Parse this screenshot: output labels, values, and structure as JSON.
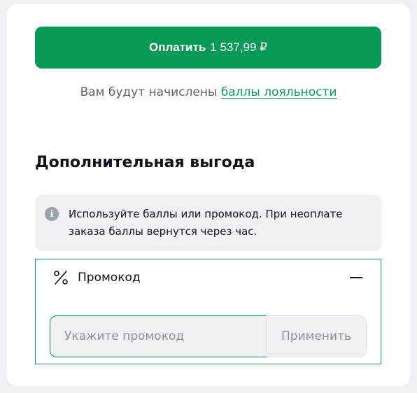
{
  "payment": {
    "pay_label": "Оплатить",
    "amount": "1 537,99 ₽"
  },
  "loyalty": {
    "prefix": "Вам будут начислены ",
    "link_text": "баллы лояльности"
  },
  "benefits": {
    "title": "Дополнительная выгода",
    "info_text": "Используйте баллы или промокод. При неоплате заказа баллы вернутся через час."
  },
  "promo": {
    "title": "Промокод",
    "input_value": "",
    "placeholder": "Укажите промокод",
    "apply_label": "Применить",
    "expanded": true
  },
  "icons": {
    "info": "info-icon",
    "percent": "percent-icon",
    "collapse": "minus-icon"
  },
  "colors": {
    "accent": "#079a56",
    "text_primary": "#101418",
    "text_muted": "#5a6472",
    "surface": "#eef0f4"
  }
}
